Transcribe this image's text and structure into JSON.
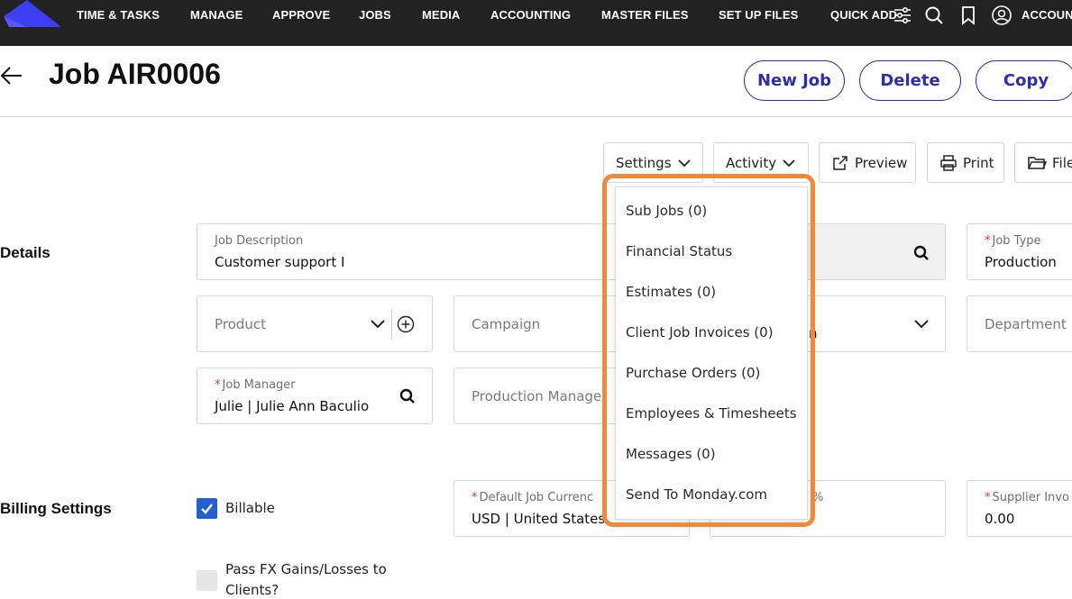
{
  "nav": {
    "items": [
      "TIME & TASKS",
      "MANAGE",
      "APPROVE",
      "JOBS",
      "MEDIA",
      "ACCOUNTING",
      "MASTER FILES",
      "SET UP FILES",
      "QUICK ADD"
    ],
    "account_label": "ACCOUN",
    "icons": [
      "sliders-icon",
      "search-icon",
      "bookmark-icon",
      "account-icon"
    ]
  },
  "header": {
    "title": "Job AIR0006",
    "buttons": {
      "new_job": "New Job",
      "delete": "Delete",
      "copy": "Copy"
    }
  },
  "toolbar": {
    "settings": "Settings",
    "activity": "Activity",
    "preview": "Preview",
    "print": "Print",
    "files": "File"
  },
  "sections": {
    "details": "Details",
    "billing": "Billing Settings"
  },
  "fields": {
    "job_description": {
      "label": "Job Description",
      "value": "Customer support I"
    },
    "job_type": {
      "label": "Job Type",
      "value": "Production"
    },
    "product": {
      "placeholder": "Product"
    },
    "campaign": {
      "placeholder": "Campaign"
    },
    "hidden_select_value": "n",
    "department": {
      "placeholder": "Department"
    },
    "job_manager": {
      "label": "Job Manager",
      "value": "Julie | Julie Ann Baculio"
    },
    "production_manager": {
      "placeholder": "Production Manager"
    },
    "default_job_currency": {
      "label": "Default Job Currenc",
      "value": "USD | United States"
    },
    "percent_label": "%",
    "supplier_invoice": {
      "label": "Supplier Invo",
      "value": "0.00"
    }
  },
  "checkboxes": {
    "billable": {
      "label": "Billable",
      "checked": true
    },
    "pass_fx": {
      "label_line1": "Pass FX Gains/Losses to",
      "label_line2": "Clients?",
      "checked": false
    }
  },
  "settings_menu": {
    "items": [
      "Sub Jobs (0)",
      "Financial Status",
      "Estimates (0)",
      "Client Job Invoices (0)",
      "Purchase Orders (0)",
      "Employees & Timesheets",
      "Messages (0)",
      "Send To Monday.com"
    ]
  },
  "colors": {
    "nav_bg": "#222222",
    "accent": "#2d2eae",
    "highlight": "#ef8a3a",
    "checkbox": "#2260d0",
    "required": "#e03131"
  }
}
